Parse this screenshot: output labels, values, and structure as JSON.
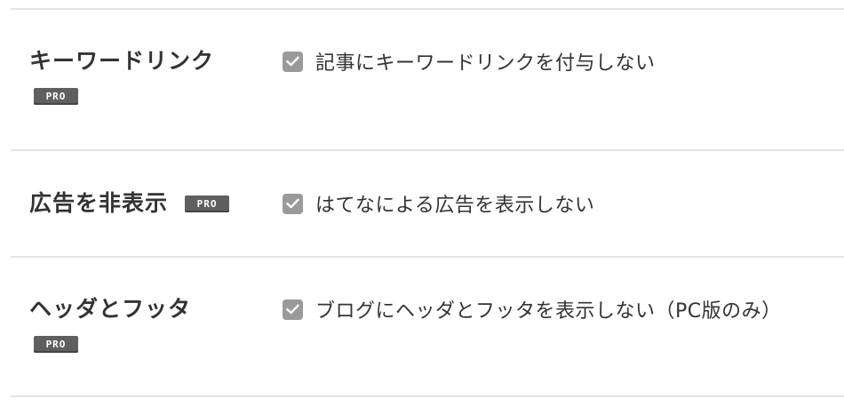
{
  "settings": [
    {
      "label": "キーワードリンク",
      "badge": "PRO",
      "option_text": "記事にキーワードリンクを付与しない",
      "checked": true
    },
    {
      "label": "広告を非表示",
      "badge": "PRO",
      "option_text": "はてなによる広告を表示しない",
      "checked": true
    },
    {
      "label": "ヘッダとフッタ",
      "badge": "PRO",
      "option_text": "ブログにヘッダとフッタを表示しない（PC版のみ）",
      "checked": true
    }
  ],
  "colors": {
    "checkbox": "#9a9a9a",
    "badge": "#5f5f5f",
    "divider": "#e4e4e4",
    "text": "#333333"
  },
  "icons": {
    "checkbox": "check-icon"
  }
}
